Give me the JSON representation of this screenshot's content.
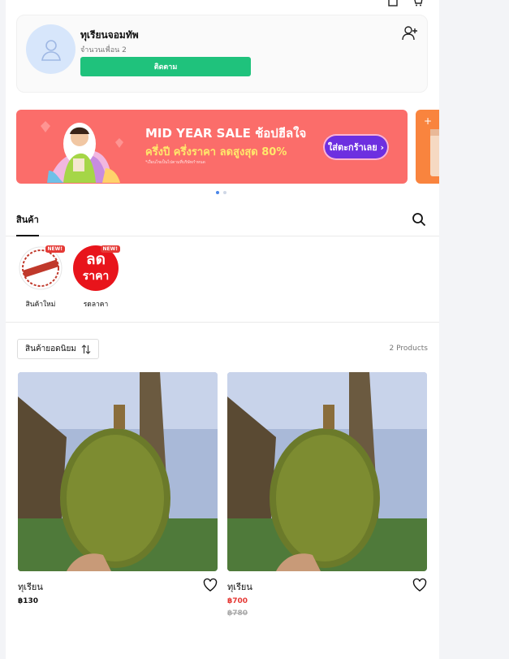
{
  "shop": {
    "name": "ทุเรียนจอมทัพ",
    "friends": "จำนวนเพื่อน 2",
    "follow_label": "ติดตาม"
  },
  "banner": {
    "title": "MID YEAR SALE ช้อปฮีลใจ",
    "subtitle": "ครึ่งปี ครึ่งราคา ลดสูงสุด 80%",
    "note": "*เงื่อนไขเป็นไปตามที่บริษัทกำหนด",
    "cta": "ใส่ตะกร้าเลย ›",
    "colors": {
      "main": "#fb6d6a",
      "cta": "#6d2fe0",
      "accent": "#ffe86b"
    }
  },
  "carousel": {
    "slides": 2,
    "active": 1
  },
  "tabs": {
    "products_label": "สินค้า"
  },
  "categories": [
    {
      "label": "สินค้าใหม่",
      "badge": "NEW!",
      "image_text": "NEW PRODUCT"
    },
    {
      "label": "รดลาคา",
      "badge": "NEW!",
      "image_text_top": "ลด",
      "image_text_bottom": "ราคา"
    }
  ],
  "listing": {
    "sort_label": "สินค้ายอดนิยม",
    "count": "2 Products"
  },
  "products": [
    {
      "name": "ทุเรียน",
      "price": "฿130"
    },
    {
      "name": "ทุเรียน",
      "price": "฿700",
      "old_price": "฿780"
    }
  ],
  "icons": [
    "bag-icon",
    "cart-icon",
    "user-placeholder-icon",
    "add-friend-icon",
    "search-icon",
    "sort-icon",
    "heart-icon"
  ]
}
